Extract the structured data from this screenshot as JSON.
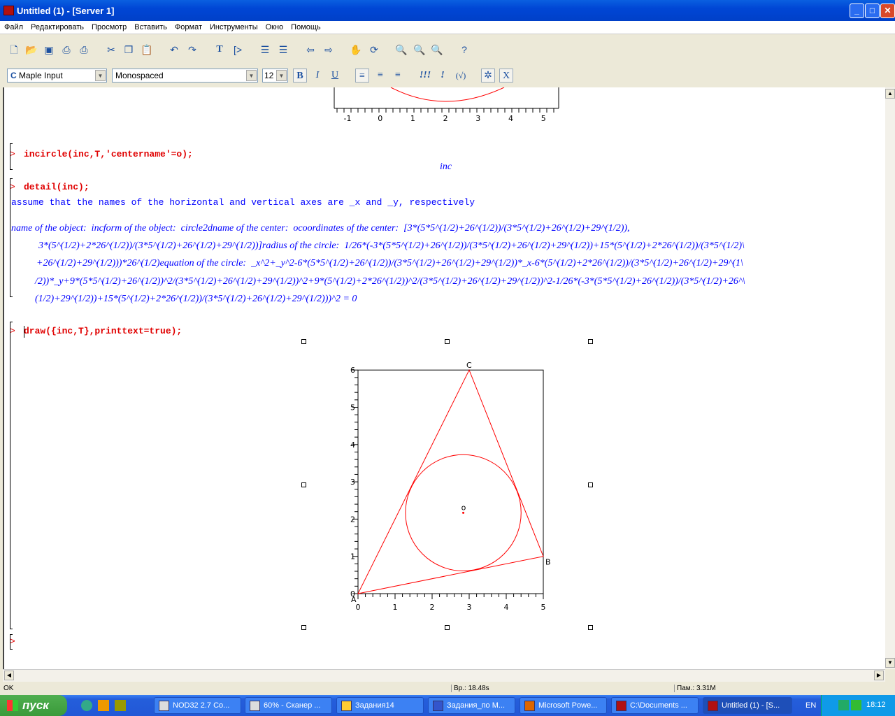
{
  "window": {
    "title": "Untitled (1) - [Server 1]",
    "min": "_",
    "max": "□",
    "close": "✕"
  },
  "menu": [
    "Файл",
    "Редактировать",
    "Просмотр",
    "Вставить",
    "Формат",
    "Инструменты",
    "Окно",
    "Помощь"
  ],
  "toolbar": {
    "icons": [
      "new-icon",
      "open-icon",
      "save-icon",
      "print-icon",
      "print-preview-icon",
      "cut-icon",
      "copy-icon",
      "paste-icon",
      "undo-icon",
      "redo-icon",
      "text-icon",
      "maple-input-icon",
      "indent-icon",
      "outdent-icon",
      "back-icon",
      "forward-icon",
      "stop-icon",
      "restart-icon",
      "zoom-100-icon",
      "zoom-150-icon",
      "zoom-200-icon",
      "help-icon"
    ]
  },
  "format": {
    "style_prefix": "C",
    "style": "Maple Input",
    "font": "Monospaced",
    "size": "12",
    "bold": "B",
    "italic": "I",
    "underline": "U",
    "exec_all": "!!!",
    "exec": "!",
    "check": "(√)",
    "x": "X"
  },
  "doc": {
    "prev_plot_ticks": [
      "-1",
      "0",
      "1",
      "2",
      "3",
      "4",
      "5"
    ],
    "prompt": ">",
    "cmd1": "incircle(inc,T,'centername'=o);",
    "out1": "inc",
    "cmd2": "detail(inc);",
    "out2": "assume that the names of the horizontal and vertical axes are _x and _y, respectively",
    "detail_lines": [
      "name of the object:  incform of the object:  circle2dname of the center:  ocoordinates of the center:  [3*(5*5^(1/2)+26^(1/2))/(3*5^(1/2)+26^(1/2)+29^(1/2)),",
      "3*(5^(1/2)+2*26^(1/2))/(3*5^(1/2)+26^(1/2)+29^(1/2))]radius of the circle:  1/26*(-3*(5*5^(1/2)+26^(1/2))/(3*5^(1/2)+26^(1/2)+29^(1/2))+15*(5^(1/2)+2*26^(1/2))/(3*5^(1/2)\\",
      "+26^(1/2)+29^(1/2)))*26^(1/2)equation of the circle:  _x^2+_y^2-6*(5*5^(1/2)+26^(1/2))/(3*5^(1/2)+26^(1/2)+29^(1/2))*_x-6*(5^(1/2)+2*26^(1/2))/(3*5^(1/2)+26^(1/2)+29^(1\\",
      "/2))*_y+9*(5*5^(1/2)+26^(1/2))^2/(3*5^(1/2)+26^(1/2)+29^(1/2))^2+9*(5^(1/2)+2*26^(1/2))^2/(3*5^(1/2)+26^(1/2)+29^(1/2))^2-1/26*(-3*(5*5^(1/2)+26^(1/2))/(3*5^(1/2)+26^\\",
      "(1/2)+29^(1/2))+15*(5^(1/2)+2*26^(1/2))/(3*5^(1/2)+26^(1/2)+29^(1/2)))^2 = 0"
    ],
    "cmd3": "draw({inc,T},printtext=true);"
  },
  "chart_data": {
    "type": "scatter",
    "xlim": [
      0,
      5
    ],
    "ylim": [
      0,
      6
    ],
    "x_ticks": [
      "0",
      "1",
      "2",
      "3",
      "4",
      "5"
    ],
    "y_ticks": [
      "0",
      "1",
      "2",
      "3",
      "4",
      "5",
      "6"
    ],
    "triangle": [
      {
        "label": "A",
        "x": 0,
        "y": 0
      },
      {
        "label": "B",
        "x": 5,
        "y": 1
      },
      {
        "label": "C",
        "x": 3,
        "y": 6
      }
    ],
    "incircle": {
      "center_label": "o",
      "cx": 2.841,
      "cy": 2.17,
      "r": 1.56
    },
    "color": "#ff0000"
  },
  "status": {
    "left": "OK",
    "time": "Вр.: 18.48s",
    "mem": "Пам.: 3.31M"
  },
  "taskbar": {
    "start": "пуск",
    "tasks": [
      "NOD32 2.7 Co...",
      "60% - Сканер ...",
      "Задания14",
      "Задания_по М...",
      "Microsoft Powe...",
      "C:\\Documents ...",
      "Untitled (1) - [S..."
    ],
    "lang": "EN",
    "clock": "18:12"
  }
}
